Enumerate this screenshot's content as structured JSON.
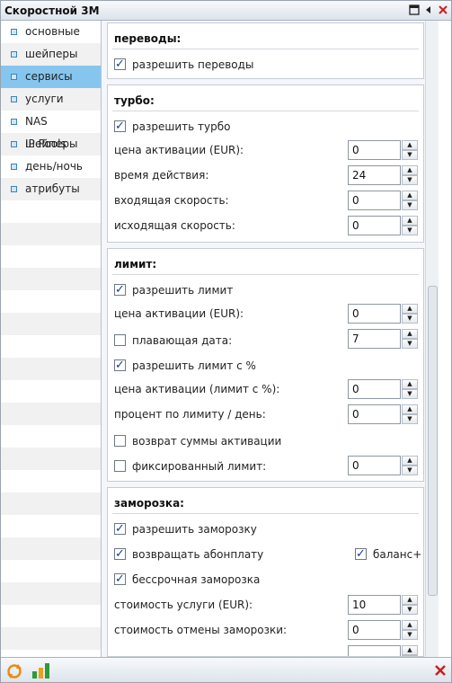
{
  "window": {
    "title": "Скоростной 3M"
  },
  "titlebar_icons": [
    "maximize-icon",
    "collapse-left-icon",
    "close-icon"
  ],
  "sidebar": {
    "items": [
      {
        "label": "основные",
        "active": false
      },
      {
        "label": "шейперы",
        "active": false
      },
      {
        "label": "сервисы",
        "active": true
      },
      {
        "label": "услуги",
        "active": false
      },
      {
        "label": "NAS шейперы",
        "active": false
      },
      {
        "label": "IP Pools",
        "active": false
      },
      {
        "label": "день/ночь",
        "active": false
      },
      {
        "label": "атрибуты",
        "active": false
      }
    ]
  },
  "sections": {
    "transfers": {
      "title": "переводы:",
      "allow": {
        "label": "разрешить переводы",
        "checked": true
      }
    },
    "turbo": {
      "title": "турбо:",
      "allow": {
        "label": "разрешить турбо",
        "checked": true
      },
      "price": {
        "label": "цена активации (EUR):",
        "value": "0"
      },
      "duration": {
        "label": "время действия:",
        "value": "24"
      },
      "in_speed": {
        "label": "входящая скорость:",
        "value": "0"
      },
      "out_speed": {
        "label": "исходящая скорость:",
        "value": "0"
      }
    },
    "limit": {
      "title": "лимит:",
      "allow": {
        "label": "разрешить лимит",
        "checked": true
      },
      "price": {
        "label": "цена активации (EUR):",
        "value": "0"
      },
      "floating_date": {
        "label": "плавающая дата:",
        "checked": false,
        "value": "7"
      },
      "allow_percent": {
        "label": "разрешить лимит с %",
        "checked": true
      },
      "price_percent": {
        "label": "цена активации (лимит с %):",
        "value": "0"
      },
      "percent_per_day": {
        "label": "процент по лимиту / день:",
        "value": "0"
      },
      "refund": {
        "label": "возврат суммы активации",
        "checked": false
      },
      "fixed": {
        "label": "фиксированный лимит:",
        "checked": false,
        "value": "0"
      }
    },
    "freeze": {
      "title": "заморозка:",
      "allow": {
        "label": "разрешить заморозку",
        "checked": true
      },
      "return_fee": {
        "label": "возвращать абонплату",
        "checked": true
      },
      "balance_plus": {
        "label": "баланс+",
        "checked": true
      },
      "indefinite": {
        "label": "бессрочная заморозка",
        "checked": true
      },
      "service_cost": {
        "label": "стоимость услуги (EUR):",
        "value": "10"
      },
      "cancel_cost": {
        "label": "стоимость отмены заморозки:",
        "value": "0"
      }
    }
  },
  "footer_icons": [
    "refresh-icon",
    "chart-icon",
    "close-icon"
  ],
  "colors": {
    "active_item": "#86c6ee",
    "check": "#1a3c9c",
    "close": "#cc1f1f"
  }
}
